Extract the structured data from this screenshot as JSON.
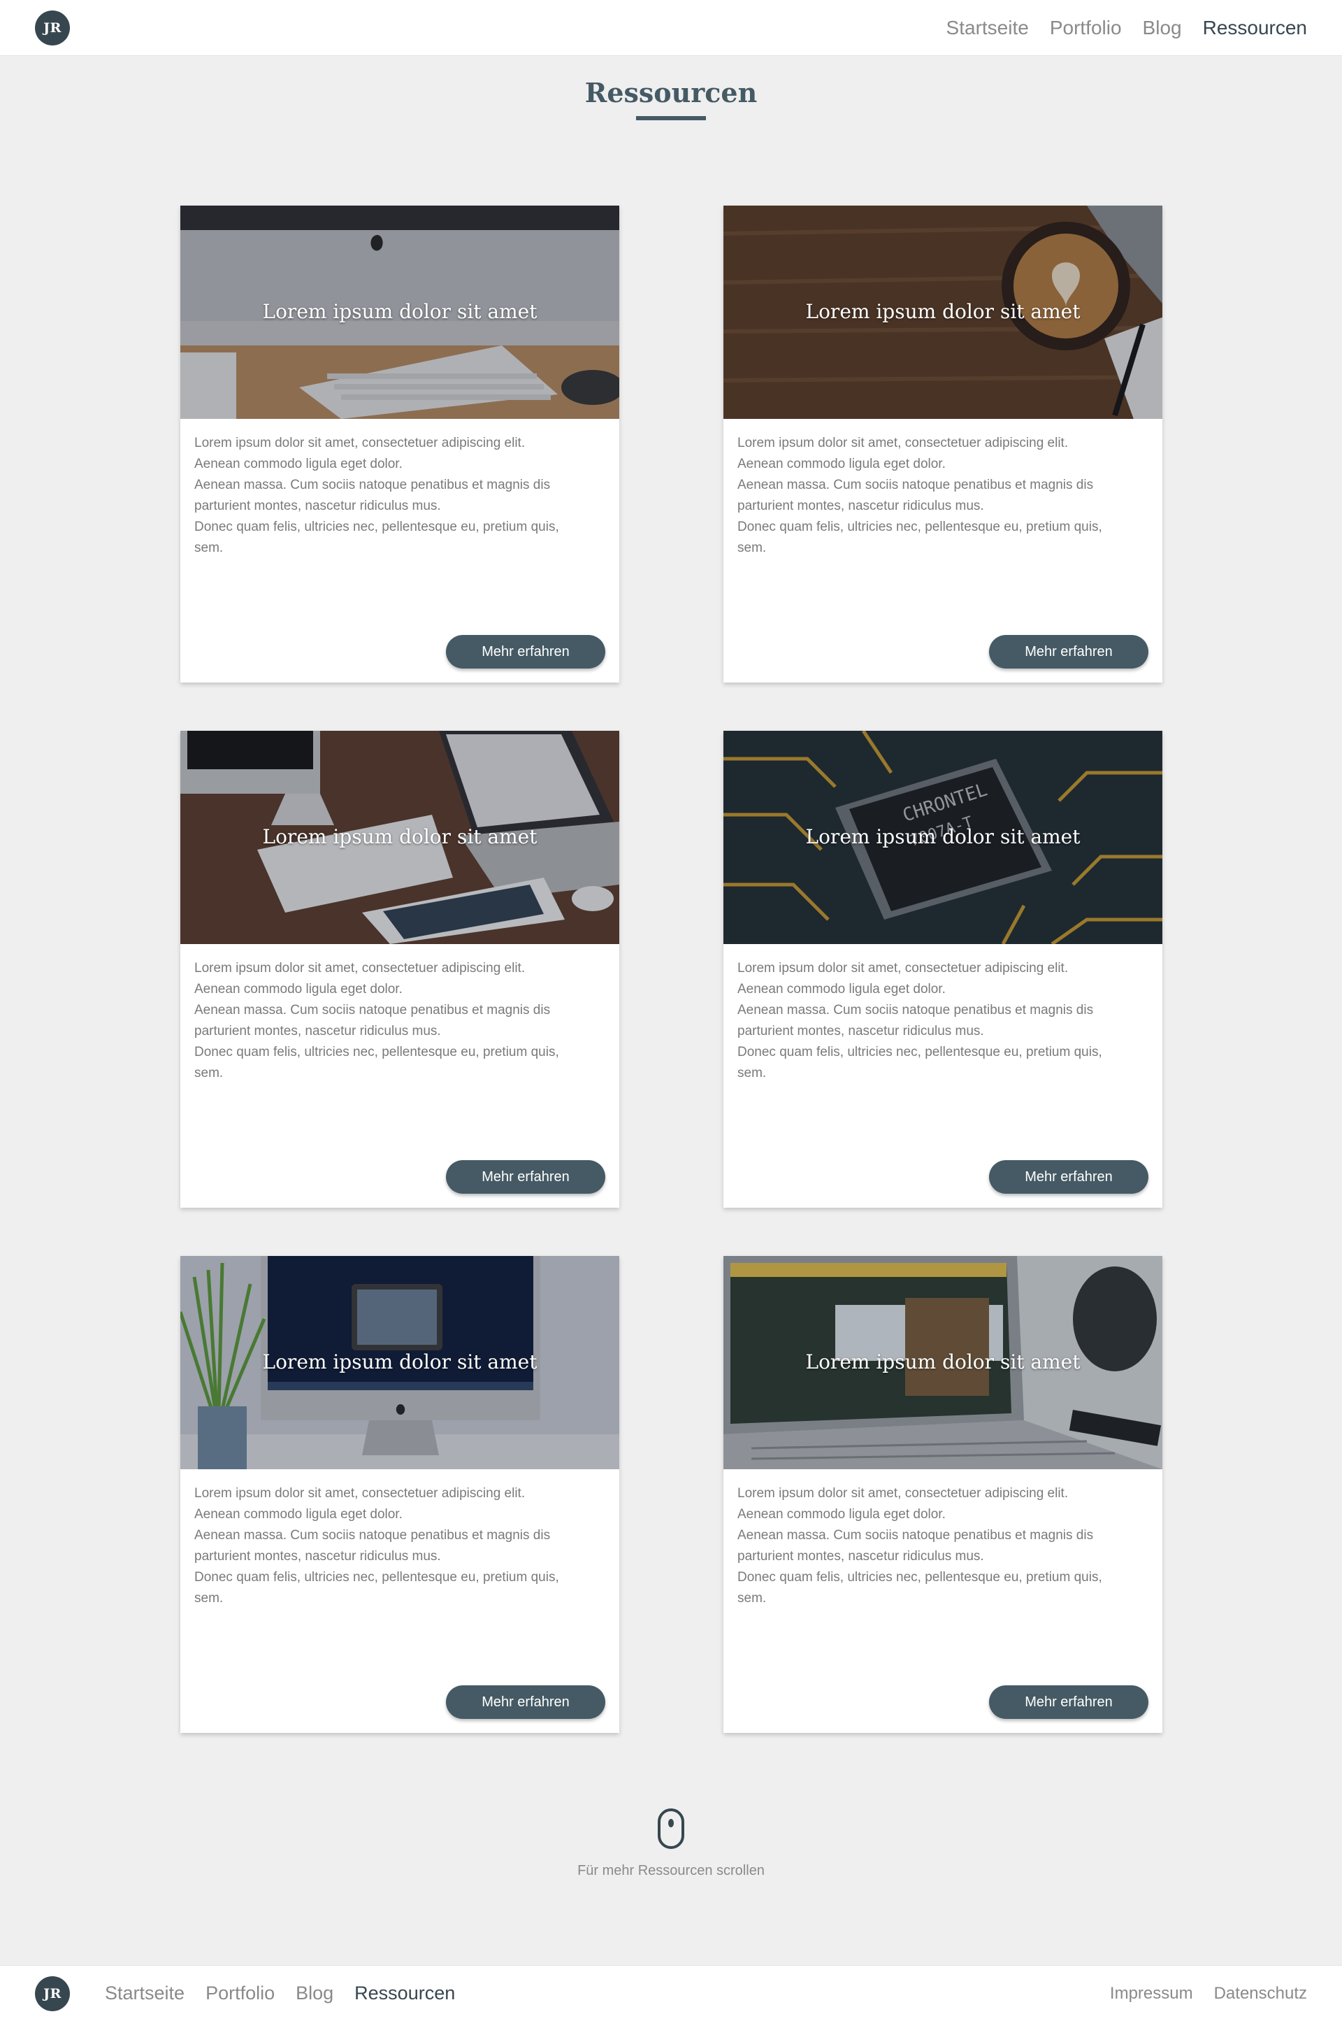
{
  "header": {
    "logo_text": "JR",
    "nav": [
      {
        "label": "Startseite",
        "active": false
      },
      {
        "label": "Portfolio",
        "active": false
      },
      {
        "label": "Blog",
        "active": false
      },
      {
        "label": "Ressourcen",
        "active": true
      }
    ]
  },
  "page": {
    "title": "Ressourcen",
    "accent_color": "#455a64"
  },
  "cards": [
    {
      "image_subject": "imac-keyboard-desk",
      "title": "Lorem ipsum dolor sit amet",
      "lines": [
        "Lorem ipsum dolor sit amet, consectetuer adipiscing elit.",
        "Aenean commodo ligula eget dolor.",
        "Aenean massa. Cum sociis natoque penatibus et magnis dis",
        "parturient montes, nascetur ridiculus mus.",
        "Donec quam felis, ultricies nec, pellentesque eu, pretium quis,",
        "sem."
      ],
      "button": "Mehr erfahren"
    },
    {
      "image_subject": "coffee-cup-wood-table",
      "title": "Lorem ipsum dolor sit amet",
      "lines": [
        "Lorem ipsum dolor sit amet, consectetuer adipiscing elit.",
        "Aenean commodo ligula eget dolor.",
        "Aenean massa. Cum sociis natoque penatibus et magnis dis",
        "parturient montes, nascetur ridiculus mus.",
        "Donec quam felis, ultricies nec, pellentesque eu, pretium quis,",
        "sem."
      ],
      "button": "Mehr erfahren"
    },
    {
      "image_subject": "imac-macbook-tablet",
      "title": "Lorem ipsum dolor sit amet",
      "lines": [
        "Lorem ipsum dolor sit amet, consectetuer adipiscing elit.",
        "Aenean commodo ligula eget dolor.",
        "Aenean massa. Cum sociis natoque penatibus et magnis dis",
        "parturient montes, nascetur ridiculus mus.",
        "Donec quam felis, ultricies nec, pellentesque eu, pretium quis,",
        "sem."
      ],
      "button": "Mehr erfahren"
    },
    {
      "image_subject": "circuit-board-chip",
      "title": "Lorem ipsum dolor sit amet",
      "lines": [
        "Lorem ipsum dolor sit amet, consectetuer adipiscing elit.",
        "Aenean commodo ligula eget dolor.",
        "Aenean massa. Cum sociis natoque penatibus et magnis dis",
        "parturient montes, nascetur ridiculus mus.",
        "Donec quam felis, ultricies nec, pellentesque eu, pretium quis,",
        "sem."
      ],
      "button": "Mehr erfahren"
    },
    {
      "image_subject": "imac-plant",
      "title": "Lorem ipsum dolor sit amet",
      "lines": [
        "Lorem ipsum dolor sit amet, consectetuer adipiscing elit.",
        "Aenean commodo ligula eget dolor.",
        "Aenean massa. Cum sociis natoque penatibus et magnis dis",
        "parturient montes, nascetur ridiculus mus.",
        "Donec quam felis, ultricies nec, pellentesque eu, pretium quis,",
        "sem."
      ],
      "button": "Mehr erfahren"
    },
    {
      "image_subject": "laptop-twitter-vase",
      "title": "Lorem ipsum dolor sit amet",
      "lines": [
        "Lorem ipsum dolor sit amet, consectetuer adipiscing elit.",
        "Aenean commodo ligula eget dolor.",
        "Aenean massa. Cum sociis natoque penatibus et magnis dis",
        "parturient montes, nascetur ridiculus mus.",
        "Donec quam felis, ultricies nec, pellentesque eu, pretium quis,",
        "sem."
      ],
      "button": "Mehr erfahren"
    }
  ],
  "scroll_hint": {
    "icon": "mouse-icon",
    "text": "Für mehr Ressourcen scrollen"
  },
  "footer": {
    "logo_text": "JR",
    "nav": [
      {
        "label": "Startseite",
        "active": false
      },
      {
        "label": "Portfolio",
        "active": false
      },
      {
        "label": "Blog",
        "active": false
      },
      {
        "label": "Ressourcen",
        "active": true
      }
    ],
    "legal": [
      {
        "label": "Impressum"
      },
      {
        "label": "Datenschutz"
      }
    ]
  }
}
